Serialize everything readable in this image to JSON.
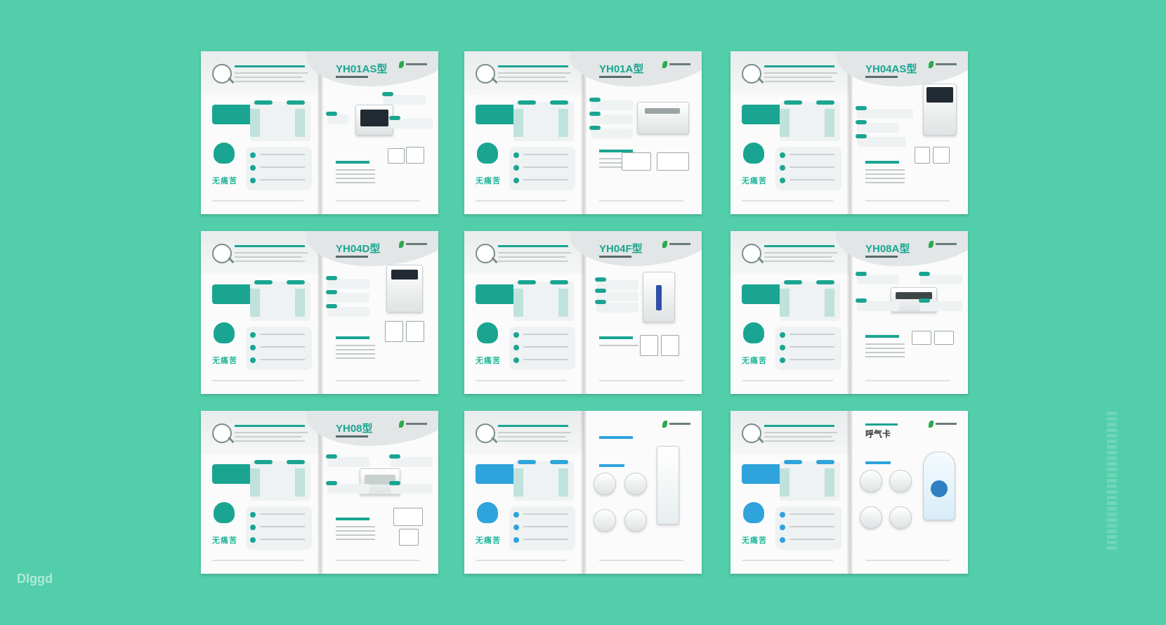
{
  "spreads": [
    {
      "title": "YH01AS型",
      "variant": "green"
    },
    {
      "title": "YH01A型",
      "variant": "green"
    },
    {
      "title": "YH04AS型",
      "variant": "green"
    },
    {
      "title": "YH04D型",
      "variant": "green"
    },
    {
      "title": "YH04F型",
      "variant": "green"
    },
    {
      "title": "YH08A型",
      "variant": "green"
    },
    {
      "title": "YH08型",
      "variant": "green"
    },
    {
      "title": "",
      "variant": "blue"
    },
    {
      "title": "呼气卡",
      "variant": "blue"
    }
  ],
  "slogan": "无痛苦",
  "watermark": "Dlggd",
  "colors": {
    "background": "#52ceaa",
    "accent": "#1aa592",
    "blue": "#2fa3dc"
  }
}
